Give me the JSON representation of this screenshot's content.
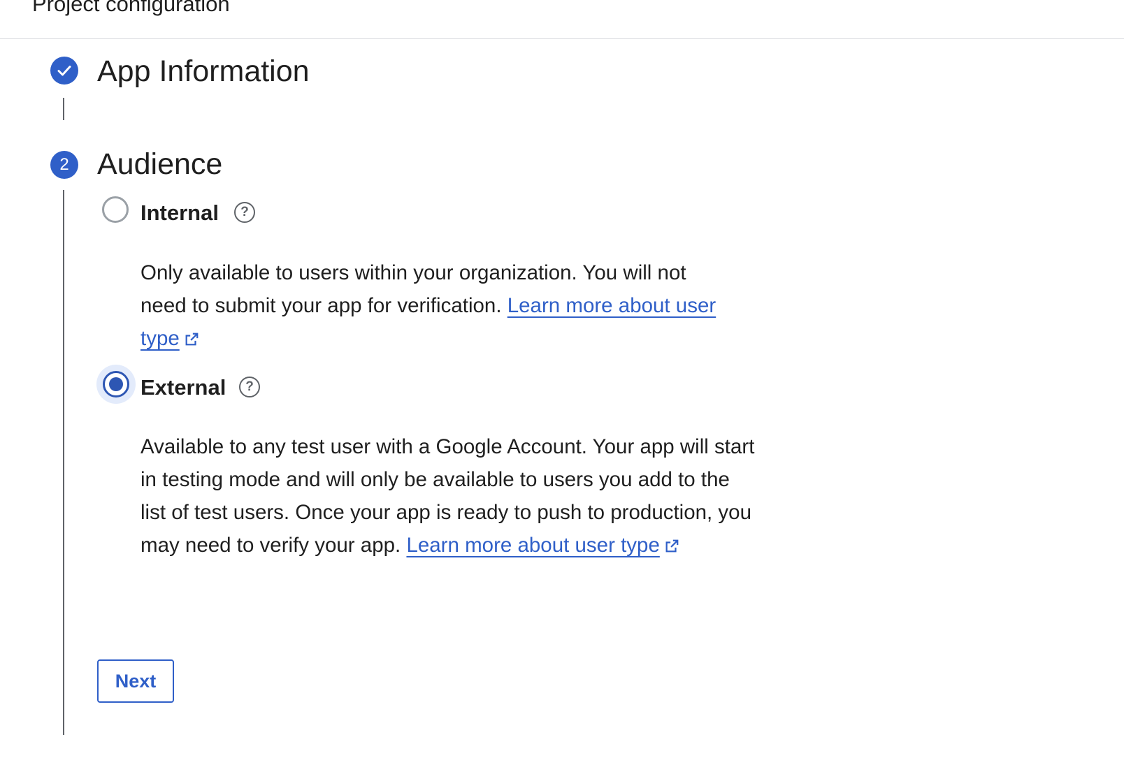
{
  "header": {
    "title": "Project configuration"
  },
  "steps": [
    {
      "title": "App Information",
      "status": "complete",
      "icon": "check-icon"
    },
    {
      "title": "Audience",
      "number": "2",
      "status": "active"
    }
  ],
  "audience": {
    "options": [
      {
        "label": "Internal",
        "selected": false,
        "description": "Only available to users within your organization. You will not need to submit your app for verification.",
        "link_text": "Learn more about user type"
      },
      {
        "label": "External",
        "selected": true,
        "description": "Available to any test user with a Google Account. Your app will start in testing mode and will only be available to users you add to the list of test users. Once your app is ready to push to production, you may need to verify your app.",
        "link_text": "Learn more about user type"
      }
    ]
  },
  "actions": {
    "next_label": "Next"
  },
  "colors": {
    "accent": "#2f5fc8",
    "text": "#1f1f1f",
    "muted": "#5f6368"
  }
}
